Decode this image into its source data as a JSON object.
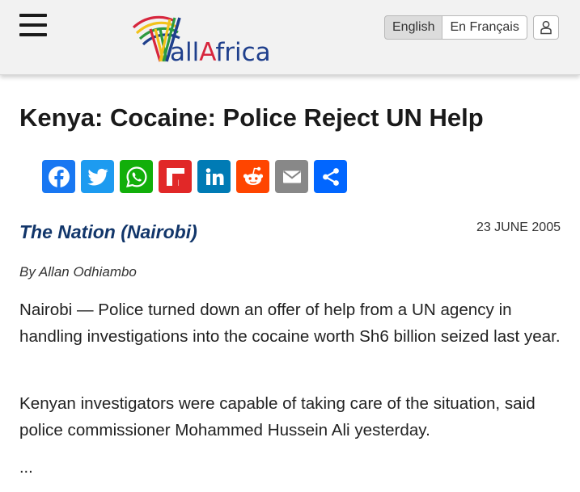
{
  "header": {
    "logo_text_prefix": "all",
    "logo_text_accent": "A",
    "logo_text_suffix": "frica",
    "languages": [
      "English",
      "En Français"
    ],
    "active_language": "English"
  },
  "article": {
    "title": "Kenya: Cocaine: Police Reject UN Help",
    "source": "The Nation (Nairobi)",
    "date": "23 JUNE 2005",
    "byline": "By Allan Odhiambo",
    "paragraphs": [
      "Nairobi — Police turned down an offer of help from a UN agency in handling investigations into the cocaine worth Sh6 billion seized last year.",
      "Kenyan investigators were capable of taking care of the situation, said police commissioner Mohammed Hussein Ali yesterday."
    ],
    "more": "..."
  },
  "share_buttons": [
    {
      "icon": "facebook-icon",
      "color": "#1877f2"
    },
    {
      "icon": "twitter-icon",
      "color": "#1d9bf0"
    },
    {
      "icon": "whatsapp-icon",
      "color": "#12af0a"
    },
    {
      "icon": "flipboard-icon",
      "color": "#e12828"
    },
    {
      "icon": "linkedin-icon",
      "color": "#007bb5"
    },
    {
      "icon": "reddit-icon",
      "color": "#ff4500"
    },
    {
      "icon": "email-icon",
      "color": "#888888"
    },
    {
      "icon": "share-icon",
      "color": "#0166ff"
    }
  ],
  "colors": {
    "source": "#12366a",
    "logo_blue": "#1f3f8c",
    "logo_red": "#d7263d",
    "logo_yellow": "#f2c21b",
    "logo_green": "#2c9a3f"
  }
}
